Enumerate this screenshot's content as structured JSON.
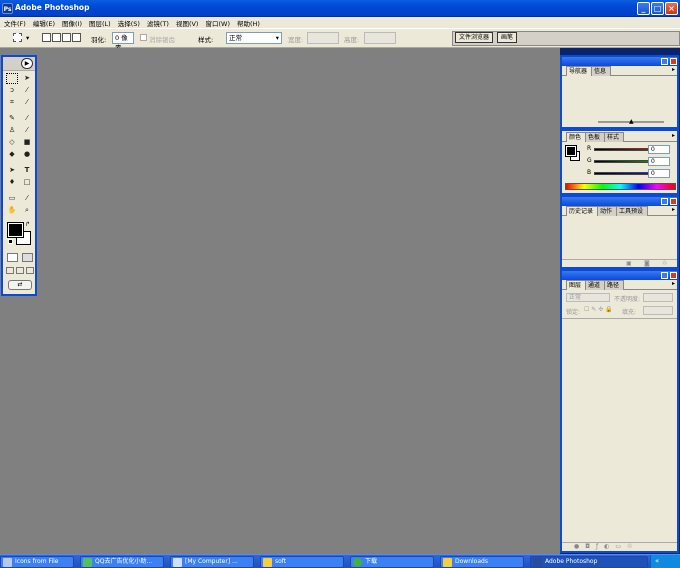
{
  "window": {
    "title": "Adobe Photoshop",
    "app_icon": "photoshop-icon"
  },
  "menu": [
    "文件(F)",
    "编辑(E)",
    "图像(I)",
    "图层(L)",
    "选择(S)",
    "滤镜(T)",
    "视图(V)",
    "窗口(W)",
    "帮助(H)"
  ],
  "options": {
    "feather_label": "羽化:",
    "feather_value": "0 像素",
    "antialias_label": "消除锯齿",
    "style_label": "样式:",
    "style_value": "正常",
    "width_label": "宽度:",
    "height_label": "高度:",
    "well_tabs": [
      "文件浏览器",
      "画笔"
    ]
  },
  "panels": {
    "navigator": {
      "tabs": [
        "导航器",
        "信息"
      ]
    },
    "color": {
      "tabs": [
        "颜色",
        "色板",
        "样式"
      ],
      "channels": [
        {
          "label": "R",
          "value": "0",
          "color": "#c02020"
        },
        {
          "label": "G",
          "value": "0",
          "color": "#20a020"
        },
        {
          "label": "B",
          "value": "0",
          "color": "#2020c0"
        }
      ]
    },
    "history": {
      "tabs": [
        "历史记录",
        "动作",
        "工具预设"
      ]
    },
    "layers": {
      "tabs": [
        "图层",
        "通道",
        "路径"
      ],
      "blend_value": "正常",
      "opacity_label": "不透明度:",
      "lock_label": "锁定:",
      "fill_label": "填充:"
    }
  },
  "taskbar": [
    {
      "label": "Icons from File",
      "active": false
    },
    {
      "label": "QQ去广告优化小助...",
      "active": false
    },
    {
      "label": "[My Computer] ...",
      "active": false
    },
    {
      "label": "soft",
      "active": false
    },
    {
      "label": "下载",
      "active": false
    },
    {
      "label": "Downloads",
      "active": false
    },
    {
      "label": "Adobe Photoshop",
      "active": true
    }
  ]
}
